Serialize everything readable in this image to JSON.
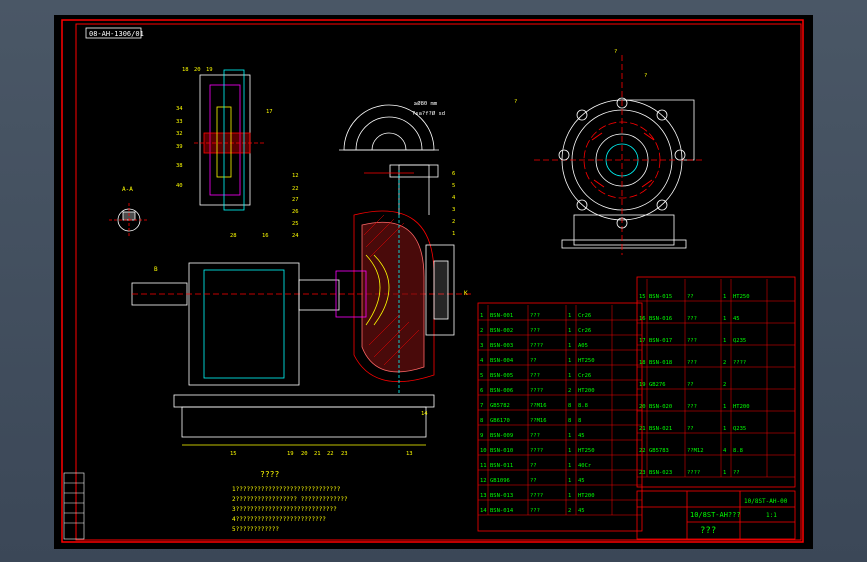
{
  "drawing": {
    "code_box": "08-AH-1306/01",
    "section_label": "A-A",
    "view_label_b": "B",
    "view_label_k": "K",
    "dim_text_top": "≥Ø80 mm",
    "dim_text_flange": "?sa?f?Ø sd",
    "title_notes_heading": "????",
    "notes": [
      "1?????????????????????????????",
      "2????????????????? ?????????????",
      "3????????????????????????????",
      "4?????????????????????????",
      "5????????????"
    ],
    "title_block": {
      "drawing_number": "10/8ST-AH???",
      "part_code": "10/8ST-AH-00",
      "company": "???",
      "scale": "1:1"
    }
  },
  "colors": {
    "workspace_bg": "#3a4656",
    "sheet_bg": "#000000",
    "frame": "#ff0000",
    "line": "#ffffff",
    "text": "#ffff00",
    "table_text": "#00ff00",
    "accent_cyan": "#00ffff"
  },
  "bom_left": [
    [
      "1",
      "BSN-001",
      "???",
      "1",
      "Cr26",
      ""
    ],
    [
      "2",
      "BSN-002",
      "???",
      "1",
      "Cr26",
      ""
    ],
    [
      "3",
      "BSN-003",
      "????",
      "1",
      "A05",
      ""
    ],
    [
      "4",
      "BSN-004",
      "??",
      "1",
      "HT250",
      ""
    ],
    [
      "5",
      "BSN-005",
      "???",
      "1",
      "Cr26",
      ""
    ],
    [
      "6",
      "BSN-006",
      "????",
      "2",
      "HT200",
      ""
    ],
    [
      "7",
      "GB5782",
      "??M16",
      "8",
      "8.8",
      ""
    ],
    [
      "8",
      "GB6170",
      "??M16",
      "8",
      "8",
      ""
    ],
    [
      "9",
      "BSN-009",
      "???",
      "1",
      "45",
      ""
    ],
    [
      "10",
      "BSN-010",
      "????",
      "1",
      "HT250",
      ""
    ],
    [
      "11",
      "BSN-011",
      "??",
      "1",
      "40Cr",
      ""
    ],
    [
      "12",
      "GB1096",
      "??",
      "1",
      "45",
      ""
    ],
    [
      "13",
      "BSN-013",
      "????",
      "1",
      "HT200",
      ""
    ],
    [
      "14",
      "BSN-014",
      "???",
      "2",
      "45",
      ""
    ]
  ],
  "bom_right": [
    [
      "15",
      "BSN-015",
      "??",
      "1",
      "HT250",
      ""
    ],
    [
      "16",
      "BSN-016",
      "???",
      "1",
      "45",
      ""
    ],
    [
      "17",
      "BSN-017",
      "???",
      "1",
      "Q235",
      ""
    ],
    [
      "18",
      "BSN-018",
      "???",
      "2",
      "????",
      ""
    ],
    [
      "19",
      "GB276",
      "??",
      "2",
      "",
      ""
    ],
    [
      "20",
      "BSN-020",
      "???",
      "1",
      "HT200",
      ""
    ],
    [
      "21",
      "BSN-021",
      "??",
      "1",
      "Q235",
      ""
    ],
    [
      "22",
      "GB5783",
      "??M12",
      "4",
      "8.8",
      ""
    ],
    [
      "23",
      "BSN-023",
      "????",
      "1",
      "??",
      ""
    ]
  ],
  "status_tabs": [
    "??",
    "??",
    "??",
    "??",
    "??",
    "??",
    "??"
  ]
}
